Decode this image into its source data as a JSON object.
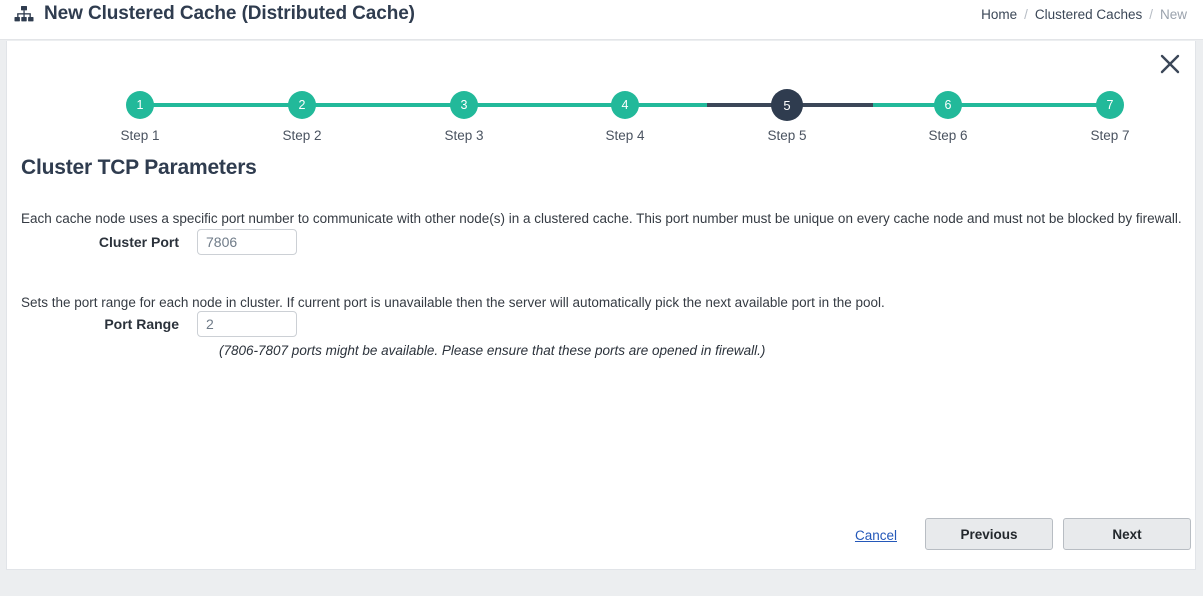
{
  "header": {
    "title": "New Clustered Cache (Distributed Cache)",
    "title_icon": "sitemap-icon",
    "breadcrumb": {
      "items": [
        "Home",
        "Clustered Caches",
        "New"
      ],
      "separator": "/"
    }
  },
  "wizard": {
    "close_icon": "close-icon",
    "current_step": 5,
    "steps": [
      {
        "number": "1",
        "label": "Step 1"
      },
      {
        "number": "2",
        "label": "Step 2"
      },
      {
        "number": "3",
        "label": "Step 3"
      },
      {
        "number": "4",
        "label": "Step 4"
      },
      {
        "number": "5",
        "label": "Step 5"
      },
      {
        "number": "6",
        "label": "Step 6"
      },
      {
        "number": "7",
        "label": "Step 7"
      }
    ],
    "section_title": "Cluster TCP Parameters",
    "description_1": "Each cache node uses a specific port number to communicate with other node(s) in a clustered cache. This port number must be unique on every cache node and must not be blocked by firewall.",
    "description_2": "Sets the port range for each node in cluster. If current port is unavailable then the server will automatically pick the next available port in the pool.",
    "fields": {
      "cluster_port": {
        "label": "Cluster Port",
        "value": "7806",
        "placeholder": "7806"
      },
      "port_range": {
        "label": "Port Range",
        "value": "2",
        "placeholder": "2"
      }
    },
    "hint": "(7806-7807 ports might be available. Please ensure that these ports are opened in firewall.)",
    "footer": {
      "cancel_label": "Cancel",
      "previous_label": "Previous",
      "next_label": "Next"
    }
  },
  "colors": {
    "accent_teal": "#22b99a",
    "active_dark": "#2f3c4f",
    "link_blue": "#2458b9"
  }
}
